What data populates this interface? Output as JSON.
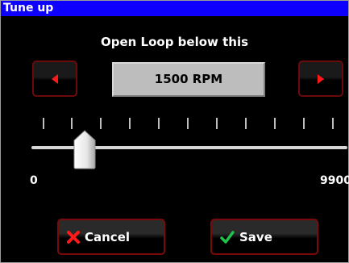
{
  "window": {
    "title": "Tune up"
  },
  "heading": "Open Loop below this",
  "value_display": "1500 RPM",
  "slider": {
    "min_label": "0",
    "max_label": "9900",
    "value": 1500,
    "min": 0,
    "max": 9900,
    "tick_count": 12
  },
  "buttons": {
    "decrease_icon": "left-arrow-icon",
    "increase_icon": "right-arrow-icon",
    "cancel_label": "Cancel",
    "save_label": "Save"
  },
  "colors": {
    "title_bar": "#0d00ff",
    "arrow": "#ff1a1a",
    "cancel_icon": "#ff1a1a",
    "save_icon": "#1fc24a"
  }
}
